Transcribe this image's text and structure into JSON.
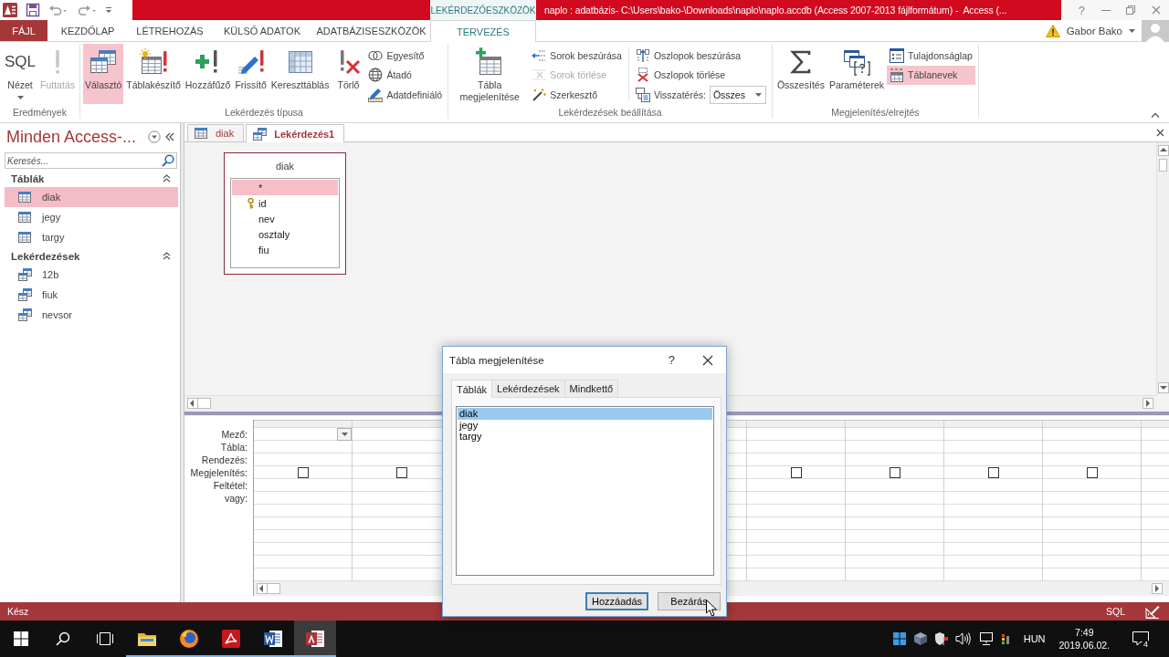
{
  "title_bar": {
    "context_header": "LEKÉRDEZŐESZKÖZÖK",
    "title": "naplo : adatbázis- C:\\Users\\bako-\\Downloads\\naplo\\naplo.accdb (Access 2007-2013 fájlformátum) -  Access (...",
    "help": "?"
  },
  "ribbon_tabs": [
    {
      "label": "FÁJL",
      "kind": "file",
      "selected": false
    },
    {
      "label": "KEZDŐLAP",
      "kind": "tab",
      "selected": false
    },
    {
      "label": "LÉTREHOZÁS",
      "kind": "tab",
      "selected": false
    },
    {
      "label": "KÜLSŐ ADATOK",
      "kind": "tab",
      "selected": false
    },
    {
      "label": "ADATBÁZISESZKÖZÖK",
      "kind": "tab",
      "selected": false
    },
    {
      "label": "TERVEZÉS",
      "kind": "context",
      "selected": true
    }
  ],
  "account": {
    "user": "Gabor Bako"
  },
  "ribbon_groups": [
    {
      "label": "Eredmények",
      "items": [
        {
          "kind": "large_menu",
          "label": "Nézet",
          "glyph": "SQL",
          "selected": false,
          "disabled": false
        },
        {
          "kind": "large",
          "label": "Futtatás",
          "selected": false,
          "disabled": true
        }
      ]
    },
    {
      "label": "Lekérdezés típusa",
      "items": [
        {
          "kind": "large",
          "label": "Választó",
          "selected": true,
          "disabled": false
        },
        {
          "kind": "large",
          "label": "Táblakészítő",
          "selected": false,
          "disabled": false
        },
        {
          "kind": "large",
          "label": "Hozzáfűző",
          "selected": false,
          "disabled": false
        },
        {
          "kind": "large",
          "label": "Frissítő",
          "selected": false,
          "disabled": false
        },
        {
          "kind": "large",
          "label": "Kereszttáblás",
          "selected": false,
          "disabled": false
        },
        {
          "kind": "large",
          "label": "Törlő",
          "selected": false,
          "disabled": false
        },
        {
          "kind": "small",
          "label": "Egyesítő",
          "selected": false,
          "disabled": false
        },
        {
          "kind": "small",
          "label": "Átadó",
          "selected": false,
          "disabled": false
        },
        {
          "kind": "small",
          "label": "Adatdefiniáló",
          "selected": false,
          "disabled": false
        }
      ]
    },
    {
      "label": "Lekérdezések beállítása",
      "items": [
        {
          "kind": "large",
          "label": "Tábla megjelenítése",
          "selected": false,
          "disabled": false
        },
        {
          "kind": "small",
          "label": "Sorok beszúrása",
          "selected": false,
          "disabled": false
        },
        {
          "kind": "small",
          "label": "Sorok törlése",
          "selected": false,
          "disabled": true
        },
        {
          "kind": "small",
          "label": "Szerkesztő",
          "selected": false,
          "disabled": false
        },
        {
          "kind": "small",
          "label": "Oszlopok beszúrása",
          "selected": false,
          "disabled": false
        },
        {
          "kind": "small",
          "label": "Oszlopok törlése",
          "selected": false,
          "disabled": false
        },
        {
          "kind": "combo",
          "label": "Visszatérés:",
          "value": "Összes",
          "selected": false,
          "disabled": false
        }
      ]
    },
    {
      "label": "Megjelenítés/elrejtés",
      "items": [
        {
          "kind": "large",
          "label": "Összesítés",
          "selected": false,
          "disabled": false
        },
        {
          "kind": "large",
          "label": "Paraméterek",
          "selected": false,
          "disabled": false
        },
        {
          "kind": "small",
          "label": "Tulajdonságlap",
          "selected": false,
          "disabled": false
        },
        {
          "kind": "small",
          "label": "Táblanevek",
          "selected": true,
          "disabled": false
        }
      ]
    }
  ],
  "nav_pane": {
    "title": "Minden Access-...",
    "search": {
      "placeholder": "Keresés..."
    },
    "sections": [
      {
        "label": "Táblák",
        "kind": "table",
        "expanded": true,
        "items": [
          {
            "label": "diak",
            "selected": true
          },
          {
            "label": "jegy",
            "selected": false
          },
          {
            "label": "targy",
            "selected": false
          }
        ]
      },
      {
        "label": "Lekérdezések",
        "kind": "query",
        "expanded": true,
        "items": [
          {
            "label": "12b",
            "selected": false
          },
          {
            "label": "fiuk",
            "selected": false
          },
          {
            "label": "nevsor",
            "selected": false
          }
        ]
      }
    ]
  },
  "document_tabs": [
    {
      "label": "diak",
      "kind": "table",
      "selected": false
    },
    {
      "label": "Lekérdezés1",
      "kind": "query",
      "selected": true
    }
  ],
  "field_list": {
    "title": "diak",
    "fields": [
      {
        "name": "*",
        "key": false,
        "selected": true
      },
      {
        "name": "id",
        "key": true,
        "selected": false
      },
      {
        "name": "nev",
        "key": false,
        "selected": false
      },
      {
        "name": "osztaly",
        "key": false,
        "selected": false
      },
      {
        "name": "fiu",
        "key": false,
        "selected": false
      }
    ]
  },
  "design_grid": {
    "row_labels": [
      "Mező:",
      "Tábla:",
      "Rendezés:",
      "Megjelenítés:",
      "Feltétel:",
      "vagy:"
    ],
    "columns": [
      {
        "checked": false,
        "dropdown": true
      },
      {
        "checked": false,
        "dropdown": false
      },
      {
        "checked": false,
        "dropdown": false
      },
      {
        "checked": false,
        "dropdown": false
      },
      {
        "checked": false,
        "dropdown": false
      },
      {
        "checked": false,
        "dropdown": false
      }
    ]
  },
  "dialog": {
    "title": "Tábla megjelenítése",
    "help": "?",
    "tabs": [
      {
        "label": "Táblák",
        "selected": true
      },
      {
        "label": "Lekérdezések",
        "selected": false
      },
      {
        "label": "Mindkettő",
        "selected": false
      }
    ],
    "list": [
      {
        "label": "diak",
        "selected": true
      },
      {
        "label": "jegy",
        "selected": false
      },
      {
        "label": "targy",
        "selected": false
      }
    ],
    "buttons": [
      {
        "label": "Hozzáadás",
        "default": true
      },
      {
        "label": "Bezárás",
        "default": false
      }
    ]
  },
  "status_bar": {
    "text": "Kész",
    "view": "SQL"
  },
  "taskbar": {
    "apps": [
      {
        "running": true,
        "active": false
      },
      {
        "running": true,
        "active": false
      },
      {
        "running": true,
        "active": false
      },
      {
        "running": true,
        "active": false
      },
      {
        "running": true,
        "active": true
      }
    ],
    "language": "HUN",
    "time": "7:49",
    "date": "2019.06.02.",
    "notifications": "4"
  }
}
